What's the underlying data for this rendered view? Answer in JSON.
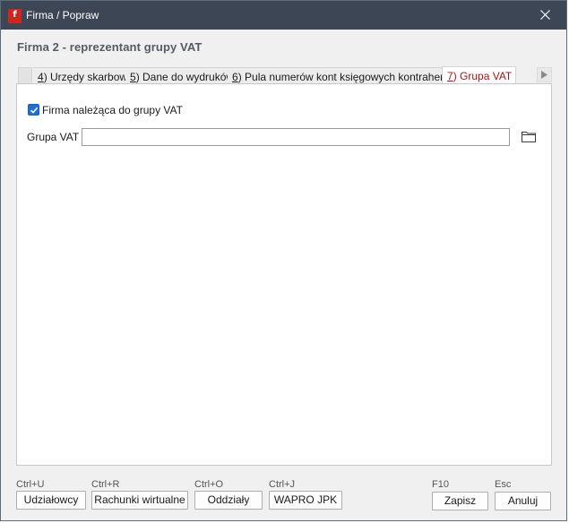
{
  "window": {
    "title": "Firma / Popraw",
    "app_icon_letter": "f",
    "close_glyph": "✕"
  },
  "heading": "Firma 2 - reprezentant grupy VAT",
  "tabs": [
    {
      "number": "4",
      "label": ") Urzędy skarbowe",
      "active": false
    },
    {
      "number": "5",
      "label": ") Dane do wydruków",
      "active": false
    },
    {
      "number": "6",
      "label": ") Pula numerów kont księgowych kontrahentów",
      "active": false
    },
    {
      "number": "7",
      "label": ") Grupa VAT",
      "active": true
    }
  ],
  "form": {
    "checkbox_label": "Firma należąca do grupy VAT",
    "checkbox_checked": true,
    "grupa_vat_label": "Grupa VAT",
    "grupa_vat_value": ""
  },
  "footer": {
    "left_buttons": [
      {
        "shortcut": "Ctrl+U",
        "label": "Udziałowcy"
      },
      {
        "shortcut": "Ctrl+R",
        "label": "Rachunki wirtualne"
      },
      {
        "shortcut": "Ctrl+O",
        "label": "Oddziały"
      },
      {
        "shortcut": "Ctrl+J",
        "label": "WAPRO JPK"
      }
    ],
    "right_buttons": [
      {
        "shortcut": "F10",
        "label": "Zapisz"
      },
      {
        "shortcut": "Esc",
        "label": "Anuluj"
      }
    ]
  },
  "colors": {
    "titlebar": "#3d4655",
    "active_tab_text": "#a31515",
    "checkbox": "#1f6fd6",
    "app_icon": "#d0251f"
  },
  "icons": {
    "close": "close-icon",
    "folder": "folder-icon",
    "tab_scroll": "triangle-right-icon",
    "checkmark": "checkmark-icon"
  }
}
